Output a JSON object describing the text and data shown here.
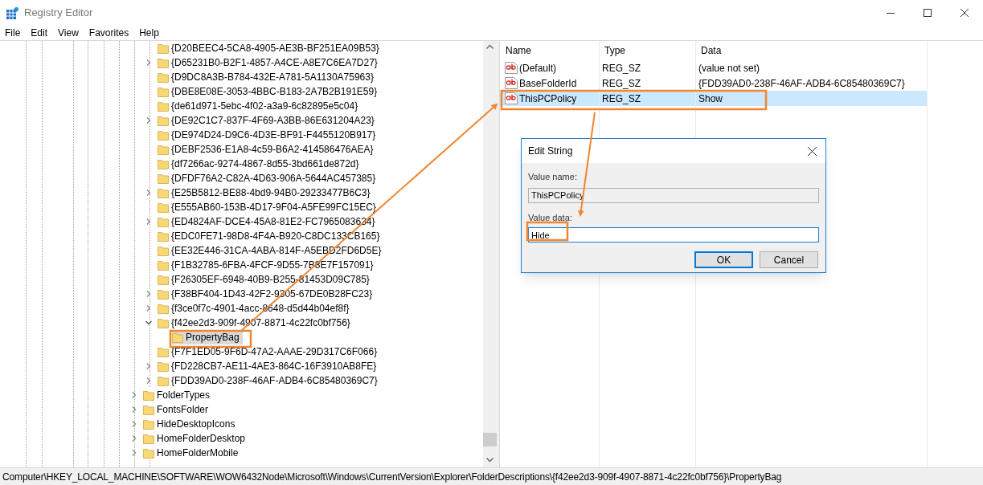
{
  "window": {
    "title": "Registry Editor"
  },
  "menu": [
    "File",
    "Edit",
    "View",
    "Favorites",
    "Help"
  ],
  "tree": {
    "items": [
      {
        "children": [
          {
            "label": "{D20BEEC4-5CA8-4905-AE3B-BF251EA09B53}",
            "has_children": false,
            "selected": false
          },
          {
            "label": "{D65231B0-B2F1-4857-A4CE-A8E7C6EA7D27}",
            "has_children": true,
            "expanded": false,
            "selected": false
          },
          {
            "label": "{D9DC8A3B-B784-432E-A781-5A1130A75963}",
            "has_children": false,
            "selected": false
          },
          {
            "label": "{DBE8E08E-3053-4BBC-B183-2A7B2B191E59}",
            "has_children": false,
            "selected": false
          },
          {
            "label": "{de61d971-5ebc-4f02-a3a9-6c82895e5c04}",
            "has_children": false,
            "selected": false
          },
          {
            "label": "{DE92C1C7-837F-4F69-A3BB-86E631204A23}",
            "has_children": true,
            "expanded": false,
            "selected": false
          },
          {
            "label": "{DE974D24-D9C6-4D3E-BF91-F4455120B917}",
            "has_children": false,
            "selected": false
          },
          {
            "label": "{DEBF2536-E1A8-4c59-B6A2-414586476AEA}",
            "has_children": false,
            "selected": false
          },
          {
            "label": "{df7266ac-9274-4867-8d55-3bd661de872d}",
            "has_children": false,
            "selected": false
          },
          {
            "label": "{DFDF76A2-C82A-4D63-906A-5644AC457385}",
            "has_children": false,
            "selected": false
          },
          {
            "label": "{E25B5812-BE88-4bd9-94B0-29233477B6C3}",
            "has_children": true,
            "expanded": false,
            "selected": false
          },
          {
            "label": "{E555AB60-153B-4D17-9F04-A5FE99FC15EC}",
            "has_children": false,
            "selected": false
          },
          {
            "label": "{ED4824AF-DCE4-45A8-81E2-FC7965083634}",
            "has_children": true,
            "expanded": false,
            "selected": false
          },
          {
            "label": "{EDC0FE71-98D8-4F4A-B920-C8DC133CB165}",
            "has_children": false,
            "selected": false
          },
          {
            "label": "{EE32E446-31CA-4ABA-814F-A5EBD2FD6D5E}",
            "has_children": false,
            "selected": false
          },
          {
            "label": "{F1B32785-6FBA-4FCF-9D55-7B8E7F157091}",
            "has_children": false,
            "selected": false
          },
          {
            "label": "{F26305EF-6948-40B9-B255-81453D09C785}",
            "has_children": false,
            "selected": false
          },
          {
            "label": "{F38BF404-1D43-42F2-9305-67DE0B28FC23}",
            "has_children": true,
            "expanded": false,
            "selected": false
          },
          {
            "label": "{f3ce0f7c-4901-4acc-8648-d5d44b04ef8f}",
            "has_children": true,
            "expanded": false,
            "selected": false
          },
          {
            "label": "{f42ee2d3-909f-4907-8871-4c22fc0bf756}",
            "has_children": true,
            "expanded": true,
            "selected": false,
            "children": [
              {
                "label": "PropertyBag",
                "has_children": false,
                "selected": true
              }
            ]
          },
          {
            "label": "{F7F1ED05-9F6D-47A2-AAAE-29D317C6F066}",
            "has_children": false,
            "selected": false
          },
          {
            "label": "{FD228CB7-AE11-4AE3-864C-16F3910AB8FE}",
            "has_children": true,
            "expanded": false,
            "selected": false
          },
          {
            "label": "{FDD39AD0-238F-46AF-ADB4-6C85480369C7}",
            "has_children": true,
            "expanded": false,
            "selected": false
          }
        ]
      },
      {
        "label": "FolderTypes",
        "has_children": true,
        "expanded": false,
        "selected": false
      },
      {
        "label": "FontsFolder",
        "has_children": true,
        "expanded": false,
        "selected": false
      },
      {
        "label": "HideDesktopIcons",
        "has_children": true,
        "expanded": false,
        "selected": false
      },
      {
        "label": "HomeFolderDesktop",
        "has_children": true,
        "expanded": false,
        "selected": false
      },
      {
        "label": "HomeFolderMobile",
        "has_children": true,
        "expanded": false,
        "selected": false
      }
    ]
  },
  "values": {
    "columns": [
      "Name",
      "Type",
      "Data"
    ],
    "rows": [
      {
        "name": "(Default)",
        "type": "REG_SZ",
        "data": "(value not set)",
        "selected": false
      },
      {
        "name": "BaseFolderId",
        "type": "REG_SZ",
        "data": "{FDD39AD0-238F-46AF-ADB4-6C85480369C7}",
        "selected": false
      },
      {
        "name": "ThisPCPolicy",
        "type": "REG_SZ",
        "data": "Show",
        "selected": true
      }
    ]
  },
  "dialog": {
    "title": "Edit String",
    "name_label": "Value name:",
    "name_value": "ThisPCPolicy",
    "data_label": "Value data:",
    "data_value": "Hide",
    "buttons": [
      {
        "label": "OK",
        "default": true
      },
      {
        "label": "Cancel",
        "default": false
      }
    ]
  },
  "status_bar": "Computer\\HKEY_LOCAL_MACHINE\\SOFTWARE\\WOW6432Node\\Microsoft\\Windows\\CurrentVersion\\Explorer\\FolderDescriptions\\{f42ee2d3-909f-4907-8871-4c22fc0bf756}\\PropertyBag"
}
